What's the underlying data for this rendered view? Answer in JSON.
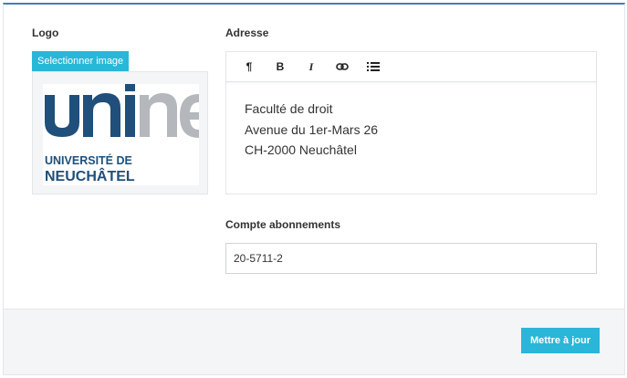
{
  "logo_section": {
    "label": "Logo",
    "select_button": "Selectionner image",
    "logo_image": {
      "name": "unine-logo",
      "text_line1": "UNIVERSITÉ DE",
      "text_line2": "NEUCHÂTEL",
      "wordmark": "unine",
      "color_dark": "#1f4f7a",
      "color_light": "#b4b8bc"
    }
  },
  "address_section": {
    "label": "Adresse",
    "toolbar": [
      {
        "icon": "paragraph-icon",
        "glyph": "¶"
      },
      {
        "icon": "bold-icon",
        "glyph": "B"
      },
      {
        "icon": "italic-icon",
        "glyph": "I"
      },
      {
        "icon": "link-icon",
        "glyph": ""
      },
      {
        "icon": "list-icon",
        "glyph": ""
      }
    ],
    "lines": [
      "Faculté de droit",
      "Avenue du 1er-Mars 26",
      "CH-2000 Neuchâtel"
    ]
  },
  "subscription": {
    "label": "Compte abonnements",
    "value": "20-5711-2"
  },
  "footer": {
    "update_button": "Mettre à jour"
  },
  "colors": {
    "accent": "#29b6d9",
    "top_border": "#3e7ebf"
  }
}
